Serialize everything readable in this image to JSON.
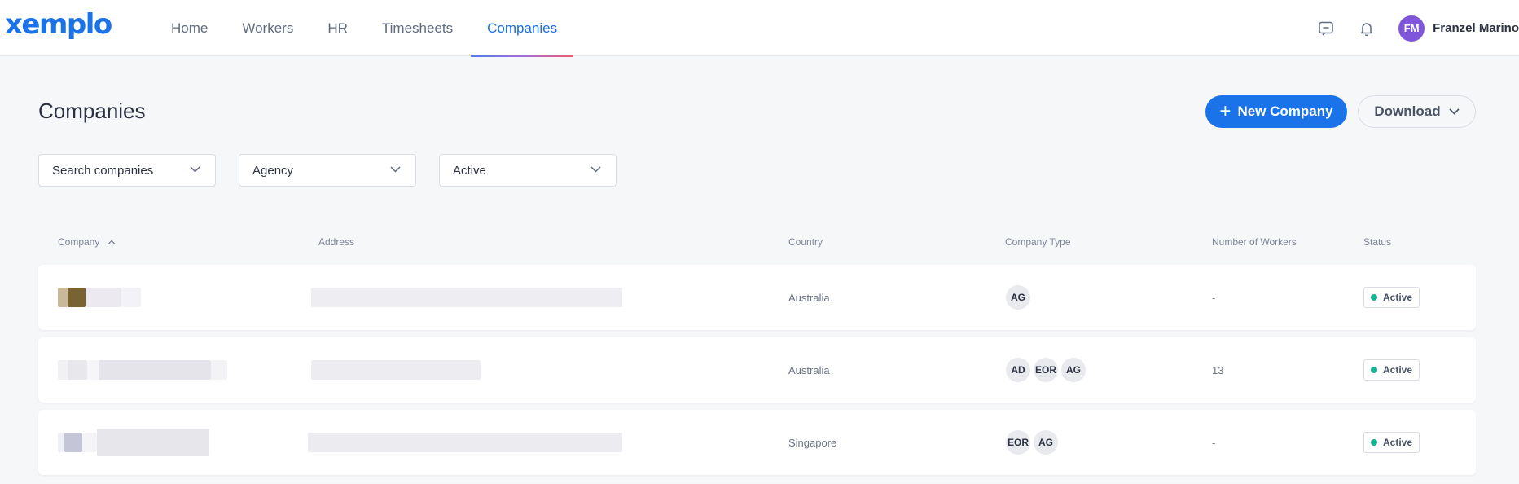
{
  "brand": {
    "logo_text": "xemplo"
  },
  "nav": {
    "items": [
      {
        "label": "Home"
      },
      {
        "label": "Workers"
      },
      {
        "label": "HR"
      },
      {
        "label": "Timesheets"
      },
      {
        "label": "Companies"
      }
    ],
    "active": "Companies"
  },
  "user": {
    "initials": "FM",
    "name": "Franzel Marino",
    "avatar_color": "#7f56d9"
  },
  "page": {
    "title": "Companies",
    "new_button": "New Company",
    "download_button": "Download"
  },
  "filters": {
    "search_placeholder": "Search companies",
    "type_value": "Agency",
    "status_value": "Active"
  },
  "table": {
    "headers": {
      "company": "Company",
      "address": "Address",
      "country": "Country",
      "type": "Company Type",
      "workers": "Number of Workers",
      "status": "Status"
    },
    "rows": [
      {
        "country": "Australia",
        "types": [
          "AG"
        ],
        "workers": "-",
        "status": "Active"
      },
      {
        "country": "Australia",
        "types": [
          "AD",
          "EOR",
          "AG"
        ],
        "workers": "13",
        "status": "Active"
      },
      {
        "country": "Singapore",
        "types": [
          "EOR",
          "AG"
        ],
        "workers": "-",
        "status": "Active"
      }
    ]
  },
  "colors": {
    "accent": "#1a73e8",
    "status_active": "#19b394",
    "background": "#f6f7f9"
  }
}
